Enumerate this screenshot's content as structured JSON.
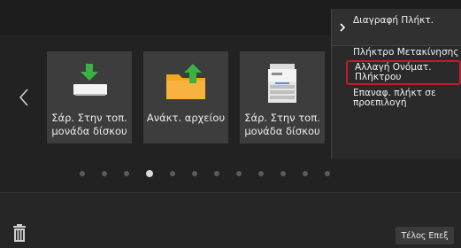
{
  "tiles": [
    {
      "label": "Σάρ. Στην τοπ. μονάδα δίσκου",
      "icon": "scan-to-drive-icon"
    },
    {
      "label": "Ανάκτ. αρχείου",
      "icon": "folder-retrieve-icon"
    },
    {
      "label": "Σάρ. Στην τοπ. μονάδα δίσκου",
      "icon": "printer-scanner-icon"
    }
  ],
  "pager": {
    "count": 12,
    "active_index": 3
  },
  "menu": {
    "items": [
      {
        "label": "Διαγραφή Πλήκτ."
      },
      {
        "label": "Πλήκτρο Μετακίνησης"
      },
      {
        "label": "Αλλαγή Ονόματ. Πλήκτρου"
      },
      {
        "label": "Επαναφ. πλήκτ σε προεπιλογή"
      }
    ]
  },
  "bottom": {
    "finish_label": "Τέλος Επεξ"
  },
  "colors": {
    "highlight": "#c21c2c",
    "selected_border": "#d6d24a"
  }
}
